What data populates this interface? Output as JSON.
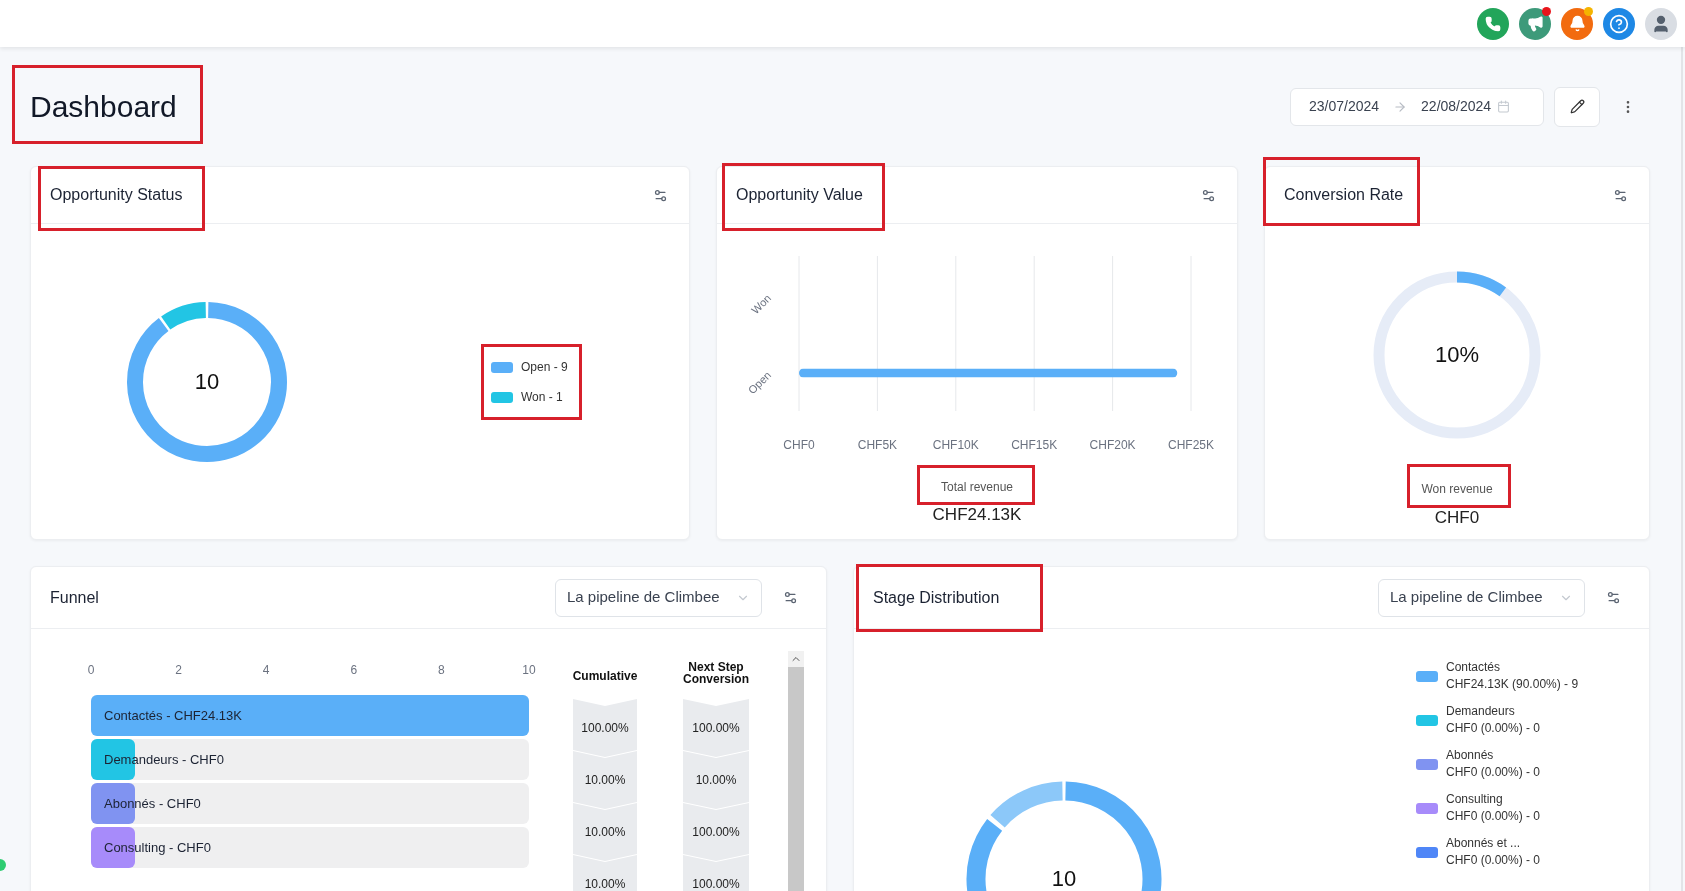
{
  "topbar": {
    "icons": [
      {
        "kind": "phone",
        "badge": false
      },
      {
        "kind": "megaphone",
        "badge": true
      },
      {
        "kind": "bell",
        "badge": true
      },
      {
        "kind": "help",
        "badge": false
      },
      {
        "kind": "avatar",
        "badge": false
      }
    ]
  },
  "page": {
    "title": "Dashboard",
    "highlighted": true
  },
  "date_range": {
    "start": "23/07/2024",
    "end": "22/08/2024"
  },
  "opportunity_status": {
    "title": "Opportunity Status",
    "highlighted": true,
    "center": "10",
    "legend": [
      {
        "label": "Open - 9",
        "color": "#5aaff8"
      },
      {
        "label": "Won - 1",
        "color": "#22c5e4"
      }
    ],
    "legend_highlighted": true
  },
  "opportunity_value": {
    "title": "Opportunity Value",
    "highlighted": true,
    "bars": [
      {
        "label": "Won"
      },
      {
        "label": "Open",
        "level": 0.965
      }
    ],
    "x_labels": [
      "CHF0",
      "CHF5K",
      "CHF10K",
      "CHF15K",
      "CHF20K",
      "CHF25K"
    ],
    "axis_title": "Total revenue",
    "axis_title_highlighted": true,
    "total": "CHF24.13K"
  },
  "conversion_rate": {
    "title": "Conversion Rate",
    "highlighted": true,
    "level": 0.1,
    "reading": "10%",
    "label": "Won revenue",
    "label_highlighted": true,
    "value": "CHF0"
  },
  "funnel": {
    "title": "Funnel",
    "pipeline": "La pipeline de Climbee",
    "stages": [
      {
        "color": "#5aaff8"
      },
      {
        "color": "#22c5e4"
      },
      {
        "color": "#8093f1"
      },
      {
        "color": "#a78bfa"
      }
    ],
    "chart_data": {
      "type": "bar",
      "orientation": "horizontal",
      "categories": [
        "Contactés - CHF24.13K",
        "Demandeurs - CHF0",
        "Abonnés - CHF0",
        "Consulting - CHF0"
      ],
      "values": [
        10,
        1,
        1,
        1
      ],
      "xlim": [
        0,
        10
      ],
      "xticks": [
        0,
        2,
        4,
        6,
        8,
        10
      ]
    },
    "cumulative_header": "Cumulative",
    "cumulative": [
      "100.00%",
      "10.00%",
      "10.00%",
      "10.00%"
    ],
    "next_step_header": "Next Step Conversion",
    "next_step": [
      "100.00%",
      "10.00%",
      "100.00%",
      "100.00%"
    ]
  },
  "stage_distribution": {
    "title": "Stage Distribution",
    "highlighted": true,
    "pipeline": "La pipeline de Climbee",
    "center": "10",
    "legend": [
      {
        "name": "Contactés",
        "detail": "CHF24.13K (90.00%) - 9",
        "color": "#5aaff8"
      },
      {
        "name": "Demandeurs",
        "detail": "CHF0 (0.00%) - 0",
        "color": "#22c5e4"
      },
      {
        "name": "Abonnés",
        "detail": "CHF0 (0.00%) - 0",
        "color": "#8093f1"
      },
      {
        "name": "Consulting",
        "detail": "CHF0 (0.00%) - 0",
        "color": "#a78bfa"
      },
      {
        "name": "Abonnés et ...",
        "detail": "CHF0 (0.00%) - 0",
        "color": "#4f86f7"
      }
    ]
  }
}
